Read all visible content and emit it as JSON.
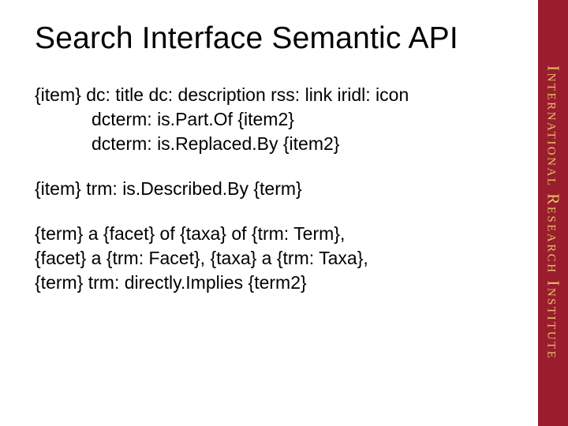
{
  "title": "Search Interface Semantic API",
  "block1": {
    "line1": "{item} dc: title dc: description rss: link iridl: icon",
    "line2": "dcterm: is.Part.Of {item2}",
    "line3": "dcterm: is.Replaced.By {item2}"
  },
  "block2": {
    "line1": "{item} trm: is.Described.By {term}"
  },
  "block3": {
    "line1": "{term} a {facet} of {taxa} of {trm: Term},",
    "line2": "{facet} a {trm: Facet}, {taxa} a {trm: Taxa},",
    "line3": "{term}  trm: directly.Implies {term2}"
  },
  "sidebar": "International Research Institute"
}
